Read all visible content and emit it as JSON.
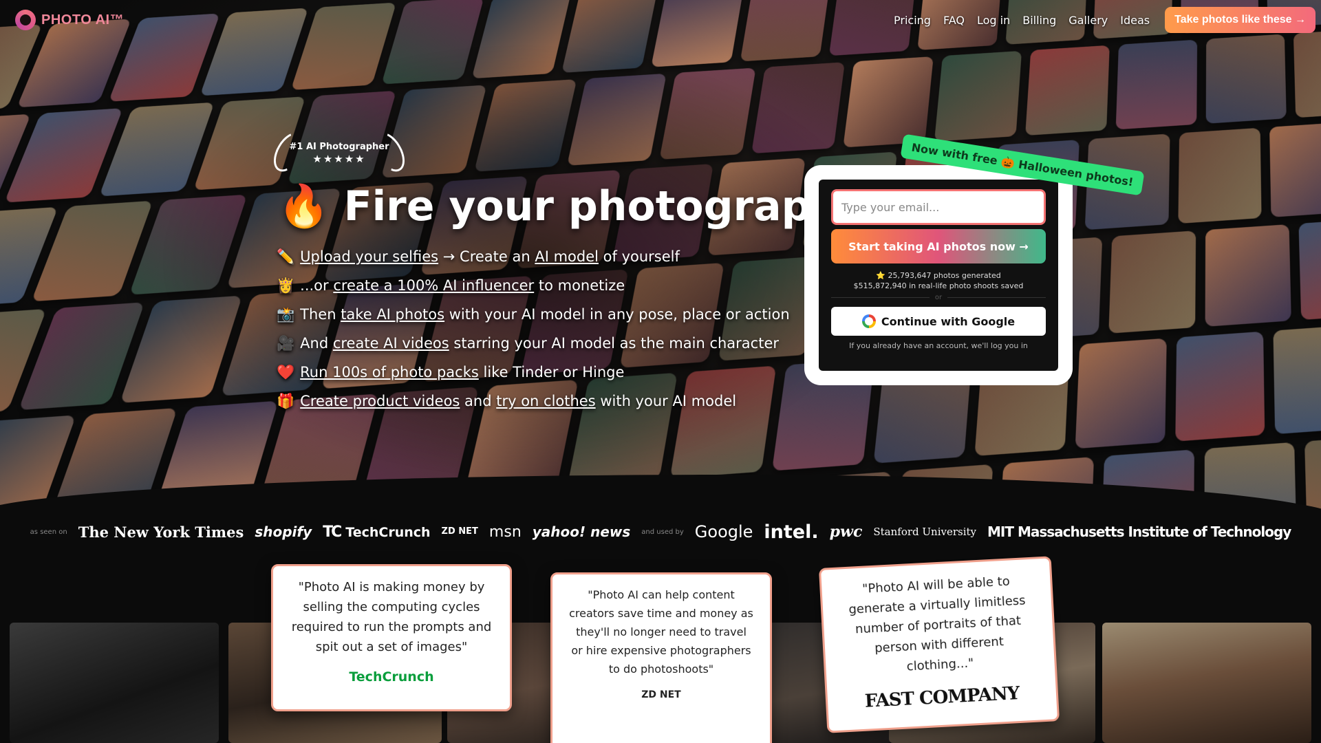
{
  "nav": {
    "logo_text": "PHOTO AI™",
    "links": [
      "Pricing",
      "FAQ",
      "Log in",
      "Billing",
      "Gallery",
      "Ideas"
    ],
    "cta": "Take photos like these →"
  },
  "hero": {
    "badge_title": "#1 AI Photographer",
    "badge_stars": "★★★★★",
    "headline_emoji": "🔥",
    "headline": "Fire your photographer",
    "bullets": [
      {
        "emoji": "✏️",
        "parts": [
          {
            "t": "Upload your selfies",
            "u": true
          },
          {
            "t": " → Create an ",
            "u": false
          },
          {
            "t": "AI model",
            "u": true
          },
          {
            "t": " of yourself",
            "u": false
          }
        ]
      },
      {
        "emoji": "👸",
        "parts": [
          {
            "t": "...or ",
            "u": false
          },
          {
            "t": "create a 100% AI influencer",
            "u": true
          },
          {
            "t": " to monetize",
            "u": false
          }
        ]
      },
      {
        "emoji": "📸",
        "parts": [
          {
            "t": "Then ",
            "u": false
          },
          {
            "t": "take AI photos",
            "u": true
          },
          {
            "t": " with your AI model in any pose, place or action",
            "u": false
          }
        ]
      },
      {
        "emoji": "🎥",
        "parts": [
          {
            "t": "And ",
            "u": false
          },
          {
            "t": "create AI videos",
            "u": true
          },
          {
            "t": " starring your AI model as the main character",
            "u": false
          }
        ]
      },
      {
        "emoji": "❤️",
        "parts": [
          {
            "t": "Run 100s of photo packs",
            "u": true
          },
          {
            "t": " like Tinder or Hinge",
            "u": false
          }
        ]
      },
      {
        "emoji": "🎁",
        "parts": [
          {
            "t": "Create product videos",
            "u": true
          },
          {
            "t": " and ",
            "u": false
          },
          {
            "t": "try on clothes",
            "u": true
          },
          {
            "t": " with your AI model",
            "u": false
          }
        ]
      }
    ]
  },
  "signup": {
    "ribbon": "Now with free 🎃 Halloween photos!",
    "email_placeholder": "Type your email...",
    "start_button": "Start taking AI photos now →",
    "stats_line1": "⭐ 25,793,647 photos generated",
    "stats_line2": "$515,872,940 in real-life photo shoots saved",
    "or": "or",
    "google_button": "Continue with Google",
    "login_note": "If you already have an account, we'll log you in"
  },
  "press": {
    "as_seen_on": "as seen on",
    "used_by": "and used by",
    "seen_logos": [
      "The New York Times",
      "shopify",
      "TechCrunch",
      "ZD NET",
      "msn",
      "yahoo! news"
    ],
    "used_logos": [
      "Google",
      "intel.",
      "pwc",
      "Stanford University",
      "MIT Massachusetts Institute of Technology"
    ]
  },
  "quotes": [
    {
      "text": "\"Photo AI is making money by selling the computing cycles required to run the prompts and spit out a set of images\"",
      "source": "TechCrunch"
    },
    {
      "text": "\"Photo AI can help content creators save time and money as they'll no longer need to travel or hire expensive photographers to do photoshoots\"",
      "source": "ZD NET"
    },
    {
      "text": "\"Photo AI will be able to generate a virtually limitless number of portraits of that person with different clothing...\"",
      "source": "FAST COMPANY"
    }
  ],
  "colors": {
    "brand_pink": "#f0889a",
    "cta_orange": "#ff9b4a",
    "ribbon_green": "#2ee079",
    "email_border": "#f47373"
  }
}
